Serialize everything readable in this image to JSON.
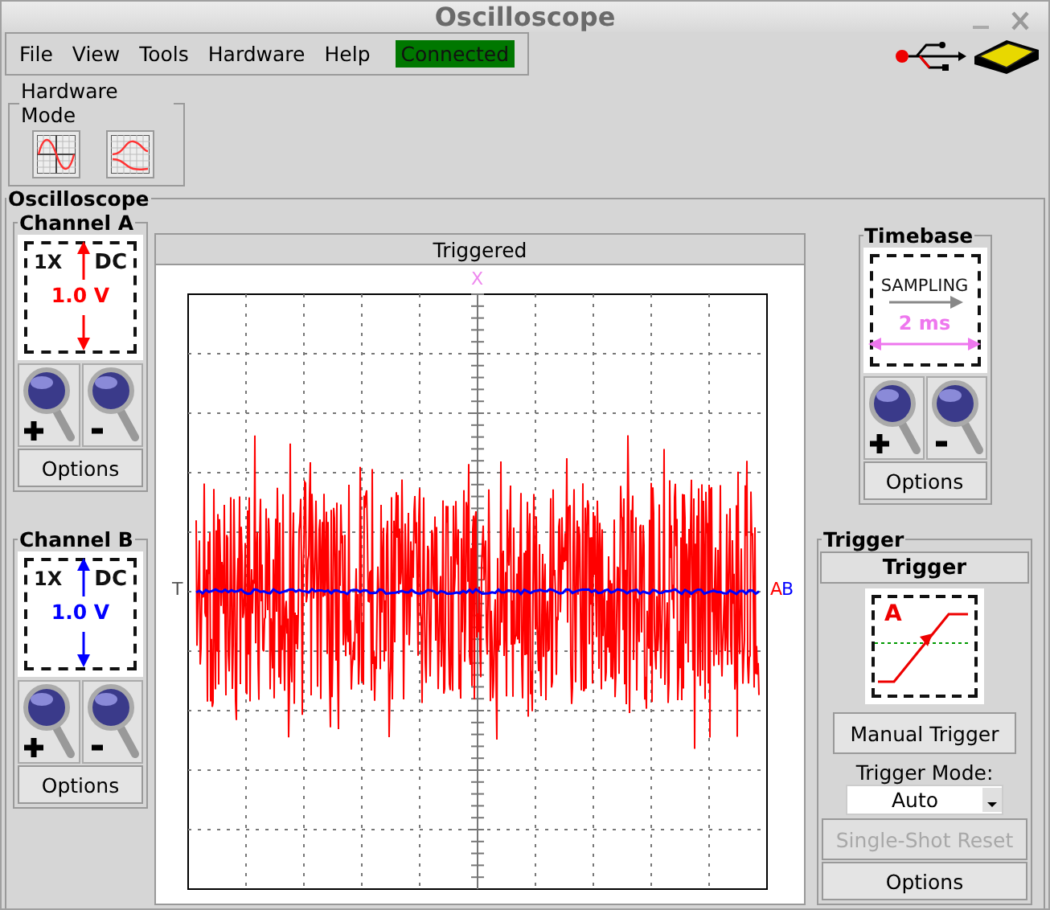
{
  "window": {
    "title": "Oscilloscope"
  },
  "menu": [
    {
      "label": "File"
    },
    {
      "label": "View"
    },
    {
      "label": "Tools"
    },
    {
      "label": "Hardware"
    },
    {
      "label": "Help"
    }
  ],
  "status": {
    "label": "Connected",
    "connected": true
  },
  "hardware_mode": {
    "title": "Hardware Mode",
    "buttons": [
      {
        "kind": "scope"
      },
      {
        "kind": "filter"
      }
    ]
  },
  "oscilloscope": {
    "title": "Oscilloscope",
    "channels": [
      {
        "title": "Channel A",
        "probe": "1X",
        "coupling": "DC",
        "range": "1.0 V",
        "color": "#ff0000",
        "options": "Options"
      },
      {
        "title": "Channel B",
        "probe": "1X",
        "coupling": "DC",
        "range": "1.0 V",
        "color": "#0000ff",
        "options": "Options"
      }
    ],
    "display": {
      "status": "Triggered",
      "x_marker": "X",
      "trigger_marker": "T",
      "channel_markers": [
        {
          "label": "A",
          "color": "#ff0000"
        },
        {
          "label": "B",
          "color": "#0000ff"
        }
      ]
    },
    "timebase": {
      "title": "Timebase",
      "mode": "SAMPLING",
      "value": "2 ms",
      "options": "Options"
    },
    "trigger": {
      "title": "Trigger",
      "header": "Trigger",
      "source": "A",
      "manual": "Manual Trigger",
      "mode_label": "Trigger Mode:",
      "mode": "Auto",
      "reset": {
        "label": "Single-Shot Reset",
        "disabled": true
      },
      "options": "Options"
    }
  }
}
